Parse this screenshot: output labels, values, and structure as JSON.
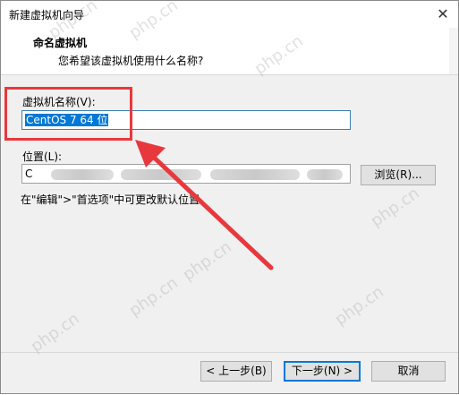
{
  "window": {
    "title": "新建虚拟机向导",
    "close_glyph": "✕"
  },
  "header": {
    "title": "命名虚拟机",
    "subtitle": "您希望该虚拟机使用什么名称?"
  },
  "form": {
    "vm_name_label": "虚拟机名称(V):",
    "vm_name_value": "CentOS 7 64 位",
    "location_label": "位置(L):",
    "location_value_visible": "C",
    "browse_label": "浏览(R)...",
    "hint": "在\"编辑\">\"首选项\"中可更改默认位置。"
  },
  "footer": {
    "back_label": "< 上一步(B)",
    "next_label": "下一步(N) >",
    "cancel_label": "取消"
  },
  "watermark_text": "php.cn",
  "colors": {
    "annotation_red": "#e8383d",
    "selection_blue": "#0078d7"
  }
}
